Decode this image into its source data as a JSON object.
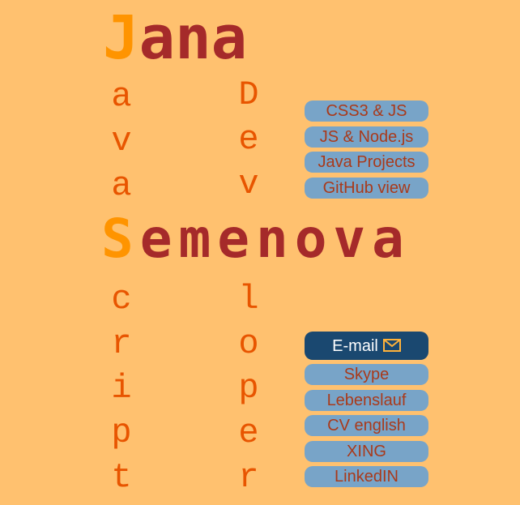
{
  "name": {
    "first_initial": "J",
    "first_rest": "ana",
    "last_initial": "S",
    "last_rest": "emenova"
  },
  "vertical": {
    "java_top": [
      "a",
      "v",
      "a"
    ],
    "java_bottom": [
      "c",
      "r",
      "i",
      "p",
      "t"
    ],
    "dev_top": [
      "D",
      "e",
      "v"
    ],
    "dev_bottom": [
      "l",
      "o",
      "p",
      "e",
      "r"
    ]
  },
  "projects": [
    {
      "label": "CSS3 & JS"
    },
    {
      "label": "JS & Node.js"
    },
    {
      "label": "Java Projects"
    },
    {
      "label": "GitHub view"
    }
  ],
  "contacts": {
    "email_label": "E-mail",
    "email_icon": "envelope-icon",
    "items": [
      {
        "label": "Skype"
      },
      {
        "label": "Lebenslauf"
      },
      {
        "label": "CV english"
      },
      {
        "label": "XING"
      },
      {
        "label": "LinkedIN"
      }
    ]
  },
  "colors": {
    "background": "#FFC16F",
    "accent_orange": "#FF9400",
    "name_brown": "#A52A2A",
    "vertical_orange": "#E85500",
    "button_blue": "#78A4C8",
    "button_text": "#A93A1B",
    "primary_button": "#1A4870"
  }
}
